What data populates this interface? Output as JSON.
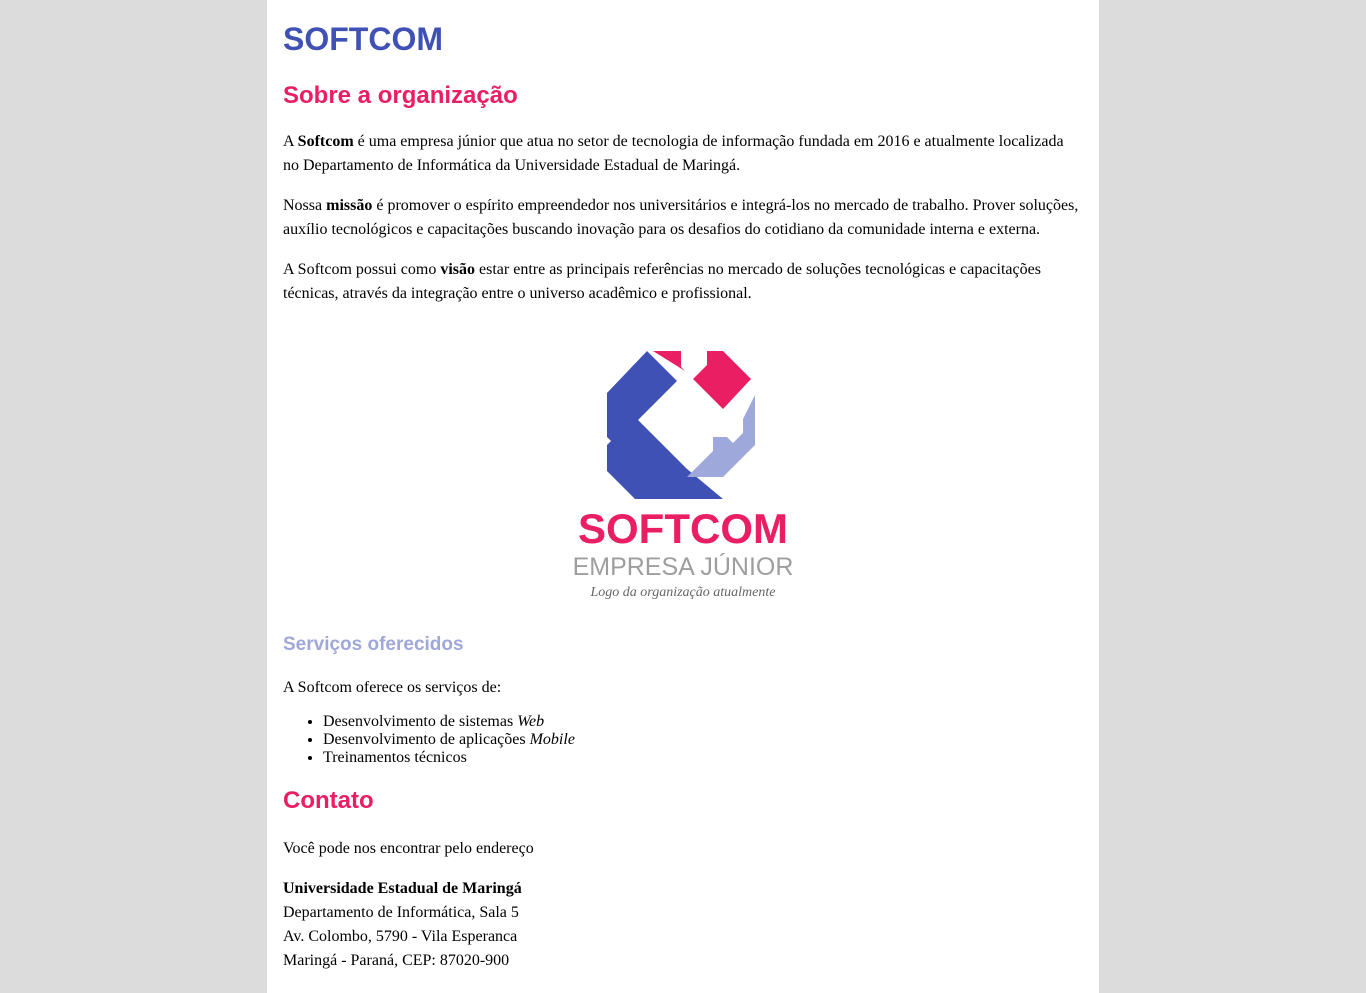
{
  "title": "SOFTCOM",
  "about": {
    "heading": "Sobre a organização",
    "p1": {
      "before": "A ",
      "bold": "Softcom",
      "after": " é uma empresa júnior que atua no setor de tecnologia de informação fundada em 2016 e atualmente localizada no Departamento de Informática da Universidade Estadual de Maringá."
    },
    "p2": {
      "before": "Nossa ",
      "bold": "missão",
      "after": " é promover o espírito empreendedor nos universitários e integrá-los no mercado de trabalho. Prover soluções, auxílio tecnológicos e capacitações buscando inovação para os desafios do cotidiano da comunidade interna e externa."
    },
    "p3": {
      "before": "A Softcom possui como ",
      "bold": "visão",
      "after": " estar entre as principais referências no mercado de soluções tecnológicas e capacitações técnicas, através da integração entre o universo acadêmico e profissional."
    }
  },
  "logo": {
    "wordmark": "SOFTCOM",
    "tagline": "EMPRESA JÚNIOR",
    "caption": "Logo da organização atualmente",
    "colors": {
      "blue": "#3f51b5",
      "pink": "#e91e63",
      "light_blue": "#9fa8da",
      "gray": "#9e9e9e"
    }
  },
  "services": {
    "heading": "Serviços oferecidos",
    "intro": "A Softcom oferece os serviços de:",
    "items": [
      {
        "text": "Desenvolvimento de sistemas ",
        "em": "Web"
      },
      {
        "text": "Desenvolvimento de aplicações ",
        "em": "Mobile"
      },
      {
        "text": "Treinamentos técnicos",
        "em": ""
      }
    ]
  },
  "contact": {
    "heading": "Contato",
    "intro": "Você pode nos encontrar pelo endereço",
    "university": "Universidade Estadual de Maringá",
    "line1": "Departamento de Informática, Sala 5",
    "line2": "Av. Colombo, 5790 - Vila Esperanca",
    "line3": "Maringá - Paraná, CEP: 87020-900"
  },
  "theme": {
    "page_bg": "#dcdcdc",
    "content_bg": "#ffffff",
    "title_color": "#3f51b5",
    "heading_color": "#e91e63",
    "subheading_color": "#9fa8da"
  }
}
